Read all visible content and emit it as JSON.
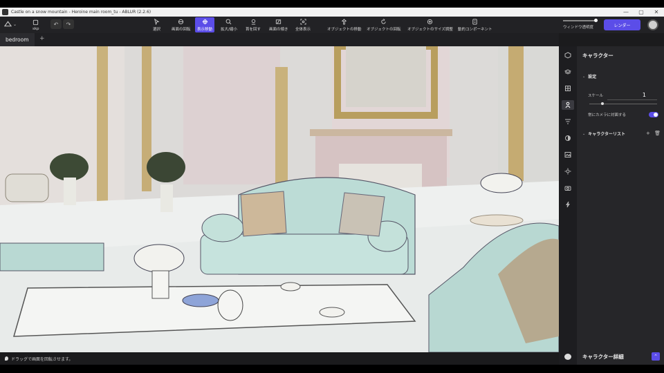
{
  "window": {
    "title": "Castle on a snow mountain - Heroine main room_tu - ABLUR (2.2.6)",
    "controls": [
      "—",
      "▢",
      "✕"
    ]
  },
  "toolbar": {
    "file_label": "skp",
    "tools": [
      {
        "label": "選択",
        "icon": "cursor-icon",
        "active": false
      },
      {
        "label": "画面の回転",
        "icon": "orbit-icon",
        "active": false
      },
      {
        "label": "表示移動",
        "icon": "pan-icon",
        "active": true
      },
      {
        "label": "拡大/縮小",
        "icon": "zoom-icon",
        "active": false
      },
      {
        "label": "首を回す",
        "icon": "look-around-icon",
        "active": false
      },
      {
        "label": "画面の傾き",
        "icon": "tilt-icon",
        "active": false
      },
      {
        "label": "全体表示",
        "icon": "fit-view-icon",
        "active": false
      },
      {
        "label": "オブジェクトの移動",
        "icon": "move-object-icon",
        "active": false
      },
      {
        "label": "オブジェクトの回転",
        "icon": "rotate-object-icon",
        "active": false
      },
      {
        "label": "オブジェクトのサイズ調整",
        "icon": "scale-object-icon",
        "active": false
      },
      {
        "label": "動的コンポーネント",
        "icon": "dynamic-component-icon",
        "active": false
      }
    ],
    "transparency_label": "ウィンドウ透明度",
    "transparency_value": 1.0,
    "render_label": "レンダー"
  },
  "tabs": {
    "active": "bedroom",
    "add": "+"
  },
  "status": {
    "hint": "ドラッグで画面を回転させます。"
  },
  "panel": {
    "title": "キャラクター",
    "settings_label": "設定",
    "scale_label": "スケール",
    "scale_value": "1",
    "face_camera_label": "常にカメラに対面する",
    "face_camera_on": true,
    "character_list_label": "キャラクターリスト",
    "list_add": "+",
    "detail_label": "キャラクター詳細"
  },
  "colors": {
    "accent": "#5b4de8",
    "panel_bg": "#262629",
    "toolbar_bg": "#222225"
  }
}
